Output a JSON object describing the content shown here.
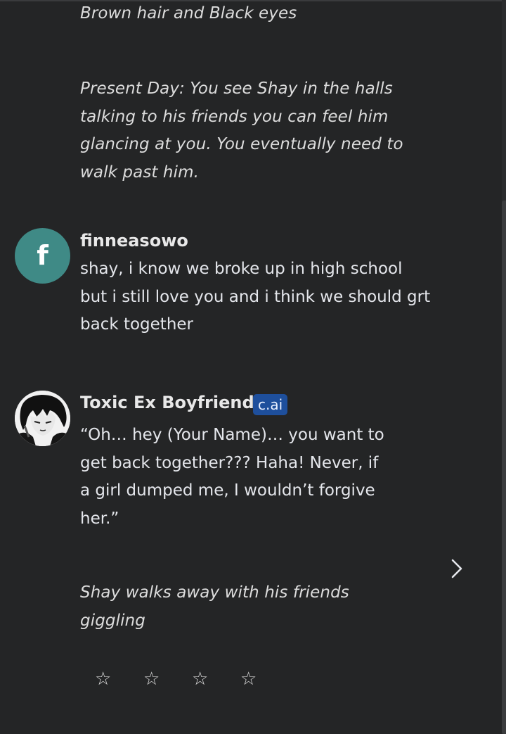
{
  "intro": {
    "appearance": "Brown hair and Black eyes",
    "scenario": "Present Day: You see Shay in the halls talking to his friends you can feel him glancing at you. You eventually need to walk past him."
  },
  "user_message": {
    "avatar_letter": "f",
    "avatar_color": "#3f8a86",
    "username": "finneasowo",
    "text": "shay, i know we broke up in high school but i still love you and i think we should grt back together"
  },
  "bot_message": {
    "name": "Toxic Ex Boyfriend",
    "badge": "c.ai",
    "badge_color": "#1e4f9c",
    "text": "“Oh… hey (Your Name)… you want to get back together??? Haha! Never, if a girl dumped me, I wouldn’t forgive her.”",
    "narration": "Shay walks away with his friends giggling"
  },
  "rating": {
    "stars": [
      "☆",
      "☆",
      "☆",
      "☆"
    ],
    "value": 0
  },
  "icons": {
    "next": "chevron-right-icon",
    "star": "star-outline-icon"
  }
}
